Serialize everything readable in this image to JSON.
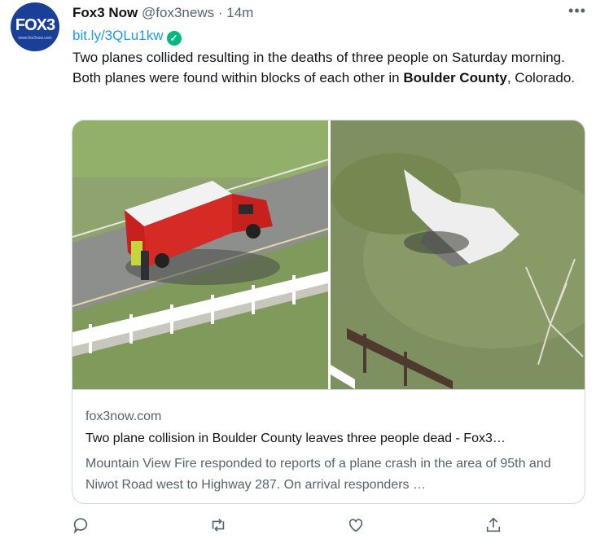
{
  "author": {
    "name": "Fox3 Now",
    "handle": "@fox3news",
    "separator": "·",
    "time": "14m",
    "avatar_text": "FOX3",
    "avatar_subtext": "www.fox3now.com"
  },
  "tweet": {
    "link": "bit.ly/3QLu1kw",
    "text_part1": "Two planes collided resulting in the deaths of three people on Saturday morning. Both planes were found within blocks of each other in ",
    "text_bold": "Boulder County",
    "text_part2": ", Colorado."
  },
  "card": {
    "domain": "fox3now.com",
    "title": "Two plane collision in Boulder County leaves three people dead - Fox3…",
    "description": "Mountain View Fire responded to reports of a plane crash in the area of 95th and Niwot Road west to Highway 287. On arrival responders …"
  },
  "menu": {
    "more_label": "•••"
  },
  "colors": {
    "accent": "#1d9bf0",
    "verified": "#00ba7c",
    "muted": "#536471",
    "avatar_bg": "#1a3f96"
  },
  "icons": [
    "more-icon",
    "verified-icon",
    "reply-icon",
    "retweet-icon",
    "like-icon",
    "share-icon"
  ]
}
